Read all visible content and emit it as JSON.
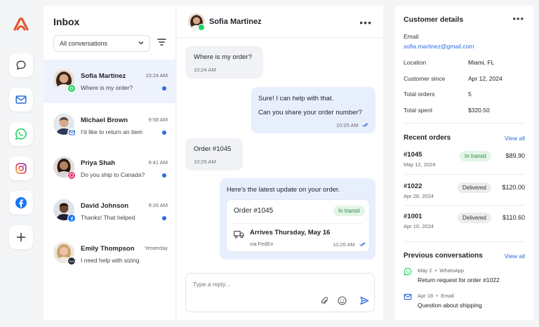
{
  "rail": {
    "items": [
      {
        "name": "chat-icon"
      },
      {
        "name": "email-icon"
      },
      {
        "name": "whatsapp-icon"
      },
      {
        "name": "instagram-icon"
      },
      {
        "name": "facebook-icon"
      },
      {
        "name": "add-icon"
      }
    ]
  },
  "inbox": {
    "title": "Inbox",
    "filter_value": "All conversations",
    "conversations": [
      {
        "name": "Sofia Martinez",
        "time": "10:24 AM",
        "message": "Where is my order?",
        "channel": "whatsapp",
        "unread": true
      },
      {
        "name": "Michael Brown",
        "time": "9:58 AM",
        "message": "I'd like to return an item",
        "channel": "email",
        "unread": true
      },
      {
        "name": "Priya Shah",
        "time": "9:41 AM",
        "message": "Do you ship to Canada?",
        "channel": "instagram",
        "unread": true
      },
      {
        "name": "David Johnson",
        "time": "9:26 AM",
        "message": "Thanks! That helped",
        "channel": "facebook",
        "unread": true
      },
      {
        "name": "Emily Thompson",
        "time": "Yesterday",
        "message": "I need help with sizing",
        "channel": "chat",
        "unread": false
      }
    ]
  },
  "chat": {
    "contact_name": "Sofia Martinez",
    "messages": {
      "m1": {
        "text": "Where is my order?",
        "time": "10:24 AM"
      },
      "m2": {
        "line1": "Sure! I can help with that.",
        "line2": "Can you share your order number?",
        "time": "10:25 AM"
      },
      "m3": {
        "text": "Order #1045",
        "time": "10:25 AM"
      },
      "m4": {
        "text": "Here's the latest update on your order.",
        "order_id": "Order #1045",
        "status": "In transit",
        "eta": "Arrives Thursday, May 16",
        "carrier": "via FedEx",
        "time": "10:26 AM"
      }
    },
    "composer_placeholder": "Type a reply..."
  },
  "details": {
    "title": "Customer details",
    "email_label": "Email",
    "email_value": "sofia.martinez@gmail.com",
    "location_label": "Location",
    "location_value": "Miami,  FL",
    "since_label": "Customer since",
    "since_value": "Apr 12, 2024",
    "orders_label": "Total orders",
    "orders_value": "5",
    "spent_label": "Total spent",
    "spent_value": "$320.50",
    "recent_title": "Recent orders",
    "recent_view_all": "View all",
    "orders": [
      {
        "id": "#1045",
        "date": "May 12, 2024",
        "status": "In transit",
        "amount": "$89.90"
      },
      {
        "id": "#1022",
        "date": "Apr 28, 2024",
        "status": "Delivered",
        "amount": "$120.00"
      },
      {
        "id": "#1001",
        "date": "Apr 10, 2024",
        "status": "Delivered",
        "amount": "$110.60"
      }
    ],
    "prev_title": "Previous conversations",
    "prev_view_all": "View all",
    "previous": [
      {
        "date": "May 2",
        "channel": "WhatsApp",
        "text": "Return request for order #1022"
      },
      {
        "date": "Apr 18",
        "channel": "Email",
        "text": "Question about shipping"
      }
    ]
  },
  "colors": {
    "accent": "#2d6ae0",
    "brand": "#e4572e",
    "whatsapp": "#25d366",
    "facebook": "#1877f2",
    "transit": "#2d8a46"
  }
}
